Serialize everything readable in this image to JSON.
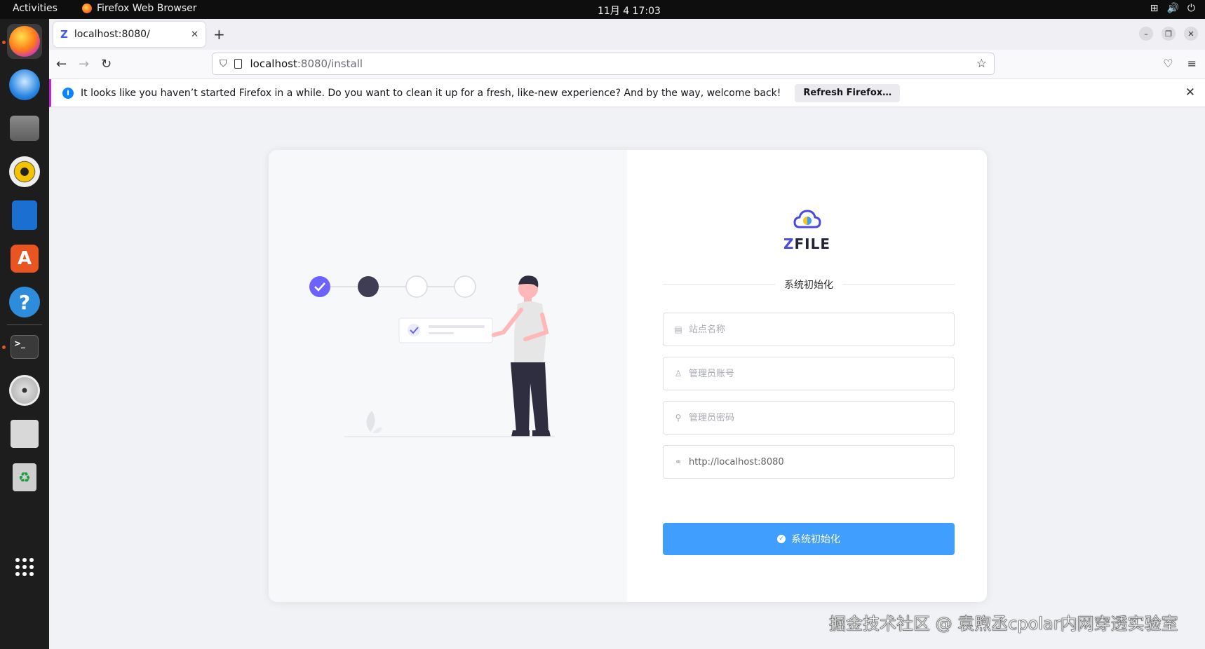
{
  "topbar": {
    "activities": "Activities",
    "app_name": "Firefox Web Browser",
    "clock": "11月 4  17:03"
  },
  "browser": {
    "tab": {
      "favicon": "Z",
      "title": "localhost:8080/"
    },
    "url": {
      "host": "localhost",
      "path": ":8080/install"
    },
    "infobar": {
      "message": "It looks like you haven’t started Firefox in a while. Do you want to clean it up for a fresh, like-new experience? And by the way, welcome back!",
      "button": "Refresh Firefox…"
    }
  },
  "page": {
    "logo_text_z": "Z",
    "logo_text_rest": "FILE",
    "section_title": "系统初始化",
    "fields": {
      "site_name": {
        "placeholder": "站点名称",
        "value": ""
      },
      "admin_user": {
        "placeholder": "管理员账号",
        "value": ""
      },
      "admin_password": {
        "placeholder": "管理员密码",
        "value": ""
      },
      "domain": {
        "placeholder": "",
        "value": "http://localhost:8080"
      }
    },
    "submit_label": "系统初始化",
    "steps_done": 1,
    "steps_total": 4
  },
  "watermark": "掘金技术社区 @ 袁煦丞cpolar内网穿透实验室",
  "colors": {
    "primary": "#409eff",
    "accent": "#6c63ff",
    "dark": "#3f3d56"
  }
}
